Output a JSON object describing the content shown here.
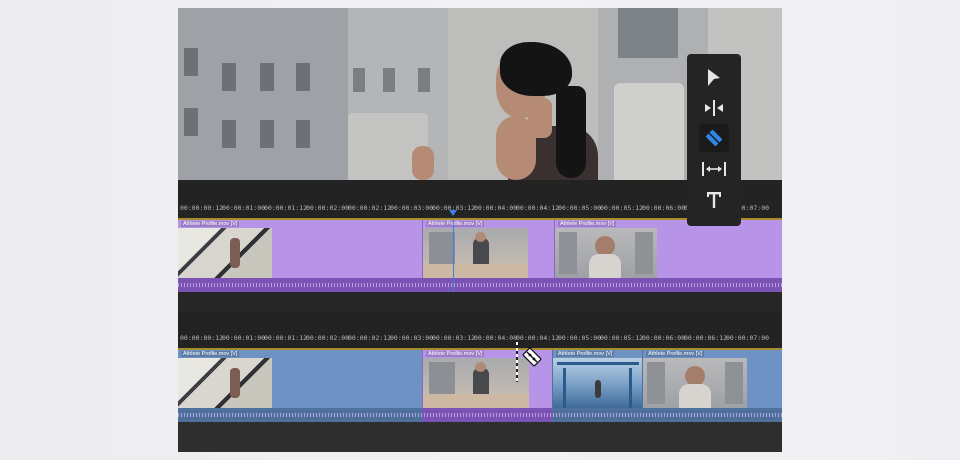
{
  "timecodes": [
    "00:00:00:12",
    "00:00:01:00",
    "00:00:01:12",
    "00:00:02:00",
    "00:00:02:12",
    "00:00:03:00",
    "00:00:03:12",
    "00:00:04:00",
    "00:00:04:12",
    "00:00:05:00",
    "00:00:05:12",
    "00:00:06:00",
    "00:00:06:12",
    "00:00:07:00"
  ],
  "tracks": {
    "top": {
      "clips": [
        "Athlete Profile.mov [V]",
        "Athlete Profile.mov [V]",
        "Athlete Profile.mov [V]"
      ]
    },
    "bottom": {
      "clips": [
        "Athlete Profile.mov [V]",
        "Athlete Profile.mov [V]",
        "Athlete Profile.mov [V]",
        "Athlete Profile.mov [V]"
      ]
    }
  },
  "tools": [
    {
      "name": "selection-tool",
      "active": false
    },
    {
      "name": "ripple-edit-tool",
      "active": false
    },
    {
      "name": "razor-tool",
      "active": true
    },
    {
      "name": "slip-tool",
      "active": false
    },
    {
      "name": "type-tool",
      "active": false
    }
  ],
  "colors": {
    "clip_purple": "#b794e8",
    "clip_blue": "#6e92c4",
    "active_tool": "#2f86e6",
    "ruler_line": "#a78c2a"
  }
}
